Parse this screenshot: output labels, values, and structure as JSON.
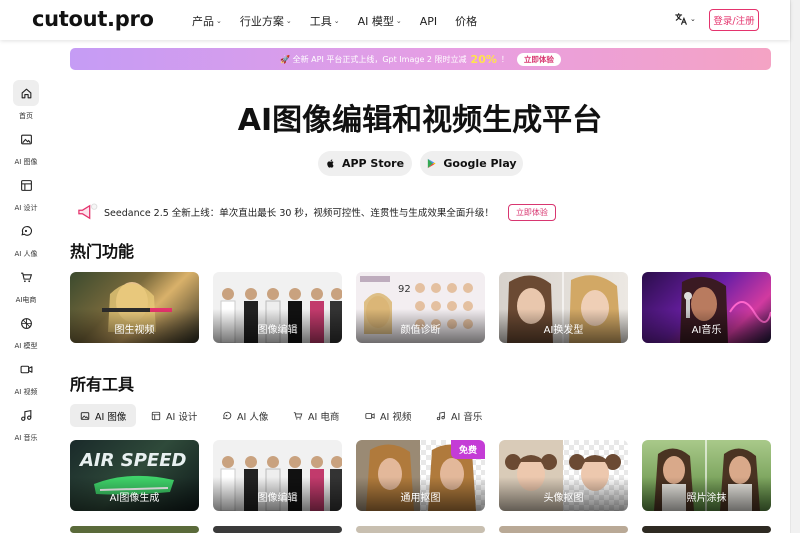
{
  "header": {
    "logo": "cutout.pro",
    "nav": [
      {
        "label": "产品",
        "dropdown": true
      },
      {
        "label": "行业方案",
        "dropdown": true
      },
      {
        "label": "工具",
        "dropdown": true
      },
      {
        "label": "AI 模型",
        "dropdown": true
      },
      {
        "label": "API",
        "dropdown": false
      },
      {
        "label": "价格",
        "dropdown": false
      }
    ],
    "language_icon": "translate-icon",
    "login_label": "登录/注册"
  },
  "sidebar": {
    "items": [
      {
        "label": "首页",
        "icon": "home-icon",
        "active": true
      },
      {
        "label": "AI 图像",
        "icon": "image-icon",
        "active": false
      },
      {
        "label": "AI 设计",
        "icon": "layout-icon",
        "active": false
      },
      {
        "label": "AI 人像",
        "icon": "face-icon",
        "active": false
      },
      {
        "label": "AI电商",
        "icon": "cart-icon",
        "active": false
      },
      {
        "label": "AI 模型",
        "icon": "model-icon",
        "active": false
      },
      {
        "label": "AI 视频",
        "icon": "video-icon",
        "active": false
      },
      {
        "label": "AI 音乐",
        "icon": "music-icon",
        "active": false
      }
    ]
  },
  "banner": {
    "text": "🚀 全新 API 平台正式上线，Gpt Image 2 限时立减",
    "percent": "20%",
    "suffix": "！",
    "button": "立即体验"
  },
  "hero": {
    "title": "AI图像编辑和视频生成平台",
    "app_store": "APP Store",
    "google_play": "Google Play"
  },
  "announcement": {
    "text": "Seedance 2.5 全新上线：单次直出最长 30 秒，视频可控性、连贯性与生成效果全面升级！",
    "button": "立即体验"
  },
  "hot_features": {
    "title": "热门功能",
    "cards": [
      {
        "label": "图生视频"
      },
      {
        "label": "图像编辑"
      },
      {
        "label": "颜值诊断"
      },
      {
        "label": "AI换发型"
      },
      {
        "label": "AI音乐"
      }
    ]
  },
  "all_tools": {
    "title": "所有工具",
    "tabs": [
      {
        "label": "AI 图像",
        "icon": "image-icon",
        "active": true
      },
      {
        "label": "AI 设计",
        "icon": "layout-icon",
        "active": false
      },
      {
        "label": "AI 人像",
        "icon": "face-icon",
        "active": false
      },
      {
        "label": "AI 电商",
        "icon": "cart-icon",
        "active": false
      },
      {
        "label": "AI 视频",
        "icon": "video-icon",
        "active": false
      },
      {
        "label": "AI 音乐",
        "icon": "music-icon",
        "active": false
      }
    ],
    "cards": [
      {
        "label": "AI图像生成",
        "badge": ""
      },
      {
        "label": "图像编辑",
        "badge": ""
      },
      {
        "label": "通用抠图",
        "badge": "免费"
      },
      {
        "label": "头像抠图",
        "badge": ""
      },
      {
        "label": "照片涂抹",
        "badge": ""
      }
    ]
  },
  "colors": {
    "accent": "#e4336d",
    "badge": "#c43cd6",
    "percent_highlight": "#ffe34d"
  }
}
